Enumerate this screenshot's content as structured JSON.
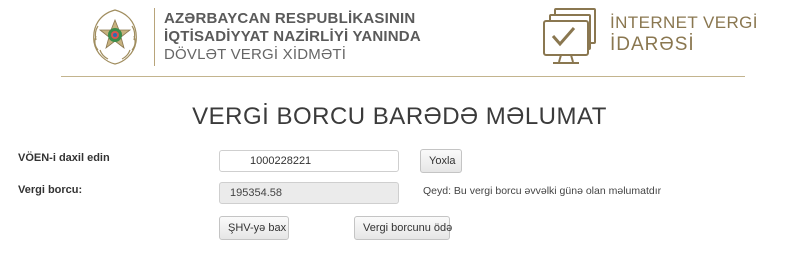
{
  "header": {
    "org_line1": "AZƏRBAYCAN RESPUBLİKASININ",
    "org_line2": "İQTİSADİYYAT NAZİRLİYİ YANINDA",
    "org_line3": "DÖVLƏT VERGİ XİDMƏTİ",
    "portal_line1": "İNTERNET VERGİ",
    "portal_line2": "İDARƏSİ",
    "accent_color": "#8a7750"
  },
  "main": {
    "title": "VERGİ BORCU BARƏDƏ MƏLUMAT",
    "voen_label": "VÖEN-i daxil edin",
    "voen_value": "1000228221",
    "check_button": "Yoxla",
    "debt_label": "Vergi borcu:",
    "debt_value": "195354.58",
    "note": "Qeyd: Bu vergi borcu əvvəlki günə olan məlumatdır",
    "shv_button": "ŞHV-yə bax",
    "pay_button": "Vergi borcunu ödə"
  }
}
